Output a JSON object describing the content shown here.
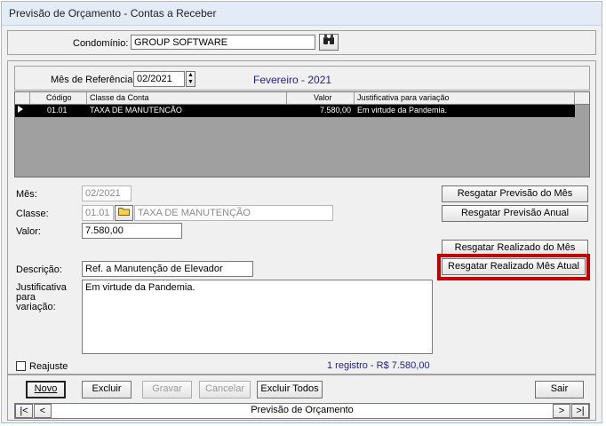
{
  "window": {
    "title": "Previsão de Orçamento - Contas a Receber"
  },
  "condominio": {
    "label": "Condomínio:",
    "value": "GROUP SOFTWARE",
    "search_icon": "binoculars-icon"
  },
  "referencia": {
    "label": "Mês de Referência:",
    "value": "02/2021",
    "month_text": "Fevereiro - 2021"
  },
  "grid": {
    "columns": [
      "Código",
      "Classe da Conta",
      "Valor",
      "Justificativa para variação"
    ],
    "rows": [
      {
        "codigo": "01.01",
        "classe": "TAXA DE MANUTENCÃO",
        "valor": "7.580,00",
        "justificativa": "Em virtude da Pandemia."
      }
    ]
  },
  "form": {
    "mes_label": "Mês:",
    "mes_value": "02/2021",
    "classe_label": "Classe:",
    "classe_code": "01.01",
    "classe_name": "TAXA DE MANUTENÇÃO",
    "valor_label": "Valor:",
    "valor_value": "7.580,00",
    "descricao_label": "Descrição:",
    "descricao_value": "Ref. a Manutenção de Elevador",
    "justificativa_label_1": "Justificativa",
    "justificativa_label_2": "para",
    "justificativa_label_3": "variação:",
    "justificativa_value": "Em virtude da Pandemia."
  },
  "side_buttons": {
    "previsao_mes": "Resgatar Previsão do Mês",
    "previsao_anual": "Resgatar Previsão Anual",
    "realizado_mes": "Resgatar Realizado do Mês",
    "realizado_mes_atual": "Resgatar Realizado Mês Atual",
    "highlight_color": "#c00000"
  },
  "reajuste": {
    "label": "Reajuste",
    "checked": false
  },
  "status": {
    "text": "1 registro - R$ 7.580,00",
    "color": "#1f1f8f"
  },
  "toolbar": {
    "novo": "Novo",
    "excluir": "Excluir",
    "gravar": "Gravar",
    "cancelar": "Cancelar",
    "excluir_todos": "Excluir Todos",
    "sair": "Sair"
  },
  "navigator": {
    "first": "|<",
    "prev": "<",
    "caption": "Previsão de Orçamento",
    "next": ">",
    "last": ">|"
  }
}
